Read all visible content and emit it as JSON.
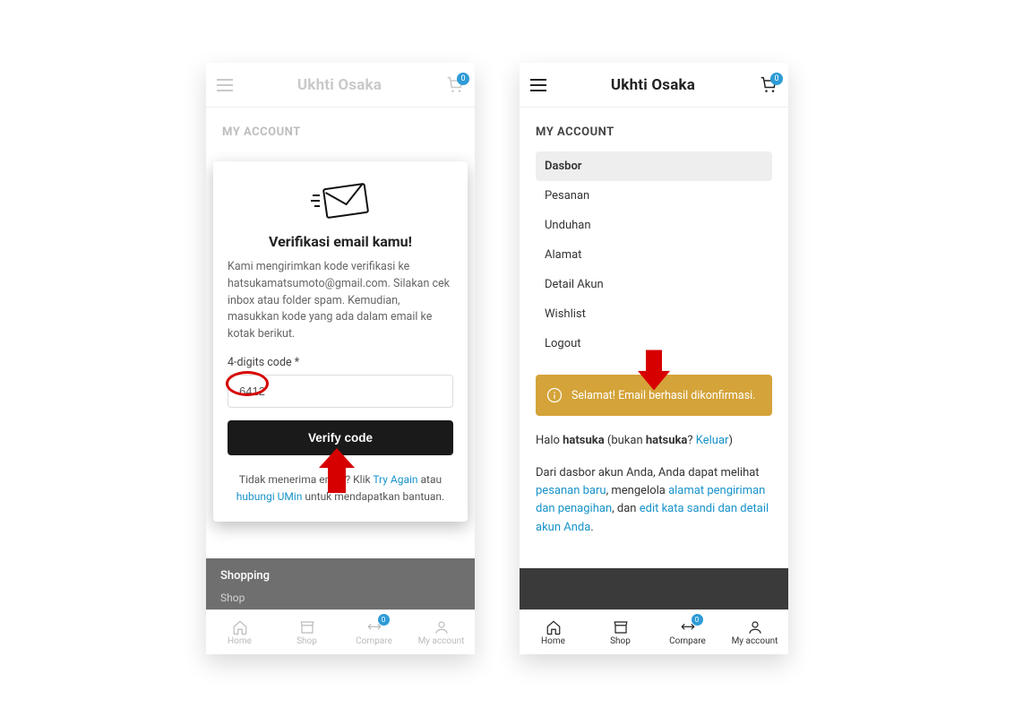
{
  "brand": "Ukhti Osaka",
  "cart_count": "0",
  "section_title": "MY ACCOUNT",
  "modal": {
    "heading": "Verifikasi email kamu!",
    "body": "Kami mengirimkan kode verifikasi ke hatsukamatsumoto@gmail.com. Silakan cek inbox atau folder spam. Kemudian, masukkan kode yang ada dalam email ke kotak berikut.",
    "field_label": "4-digits code *",
    "code_value": "6412",
    "button": "Verify code",
    "foot_pre": "Tidak menerima email? Klik ",
    "foot_link1": "Try Again",
    "foot_mid": " atau ",
    "foot_link2": "hubungi UMin",
    "foot_post": " untuk mendapatkan bantuan."
  },
  "shopping": {
    "head": "Shopping",
    "item": "Shop"
  },
  "dash_items": [
    "Dasbor",
    "Pesanan",
    "Unduhan",
    "Alamat",
    "Detail Akun",
    "Wishlist",
    "Logout"
  ],
  "alert": "Selamat! Email berhasil dikonfirmasi.",
  "welcome": {
    "hello": "Halo ",
    "username": "hatsuka",
    "not_pre": " (bukan ",
    "not_user": "hatsuka",
    "not_q": "? ",
    "logout": "Keluar",
    "close": ")",
    "p2a": "Dari dasbor akun Anda, Anda dapat melihat ",
    "link1": "pesanan baru",
    "p2b": ", mengelola ",
    "link2": "alamat pengiriman dan penagihan",
    "p2c": ", dan ",
    "link3": "edit kata sandi dan detail akun Anda",
    "p2d": "."
  },
  "nav": {
    "home": "Home",
    "shop": "Shop",
    "compare": "Compare",
    "account": "My account",
    "compare_count": "0"
  }
}
